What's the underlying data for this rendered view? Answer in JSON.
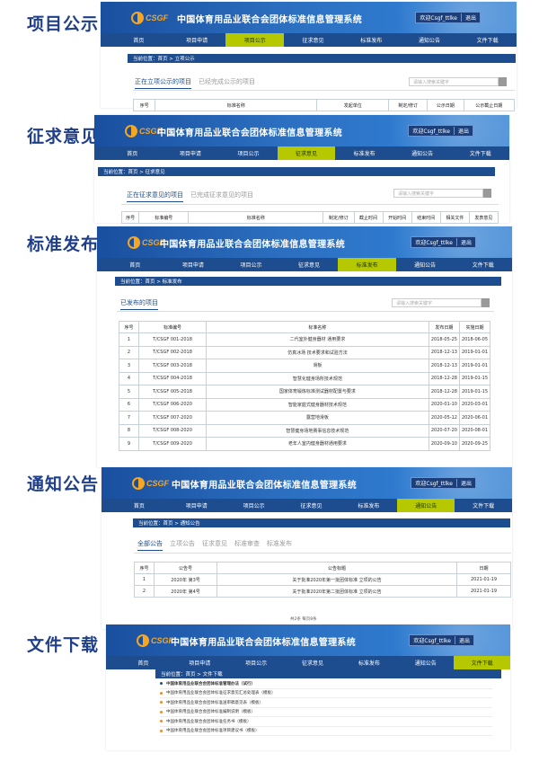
{
  "header": {
    "logo_text": "CSGF",
    "site_title": "中国体育用品业联合会团体标准信息管理系统",
    "user": "欢迎Csgf_ttlke",
    "logout": "退出"
  },
  "nav": [
    "首页",
    "项目申请",
    "项目公示",
    "征求意见",
    "标准发布",
    "通知公告",
    "文件下载"
  ],
  "sections": {
    "s1": {
      "label": "项目公示",
      "crumb": "当前位置：首页 > 立项公示",
      "tabs": [
        "正在立项公示的项目",
        "已经完成公示的项目"
      ],
      "search_placeholder": "请输入搜索关键字",
      "cols": [
        "序号",
        "标准名称",
        "发起单位",
        "制定/修订",
        "公示日期",
        "公示截止日期"
      ]
    },
    "s2": {
      "label": "征求意见",
      "crumb": "当前位置：首页 > 征求意见",
      "tabs": [
        "正在征求意见的项目",
        "已完成征求意见的项目"
      ],
      "search_placeholder": "请输入搜索关键字",
      "cols": [
        "序号",
        "标准编号",
        "标准名称",
        "制定/修订",
        "截止时间",
        "开始时间",
        "结束时间",
        "相关文件",
        "发表意见"
      ]
    },
    "s3": {
      "label": "标准发布",
      "crumb": "当前位置：首页 > 标准发布",
      "tab": "已发布的项目",
      "search_placeholder": "请输入搜索关键字",
      "cols": [
        "序号",
        "标准编号",
        "标准名称",
        "发布日期",
        "实施日期"
      ],
      "rows": [
        [
          "1",
          "T/CSGF 001-2018",
          "二代室外健身器材 通用要求",
          "2018-05-25",
          "2018-06-05"
        ],
        [
          "2",
          "T/CSGF 002-2018",
          "仿真冰场 技术要求和试验方法",
          "2018-12-13",
          "2019-01-01"
        ],
        [
          "3",
          "T/CSGF 003-2018",
          "滑板",
          "2018-12-13",
          "2019-01-01"
        ],
        [
          "4",
          "T/CSGF 004-2018",
          "智慧化健身场所技术规范",
          "2018-12-28",
          "2019-01-15"
        ],
        [
          "5",
          "T/CSGF 005-2018",
          "国家体育锻炼标准测试器材配置与要求",
          "2018-12-28",
          "2019-01-15"
        ],
        [
          "6",
          "T/CSGF 006-2020",
          "智能家庭式健身器材技术规范",
          "2020-01-10",
          "2020-03-01"
        ],
        [
          "7",
          "T/CSGF 007-2020",
          "露营地滑板",
          "2020-05-12",
          "2020-06-01"
        ],
        [
          "8",
          "T/CSGF 008-2020",
          "智慧健身场地赛事信息技术规范",
          "2020-07-20",
          "2020-08-01"
        ],
        [
          "9",
          "T/CSGF 009-2020",
          "老年人室内健身器材通用要求",
          "2020-09-10",
          "2020-09-25"
        ]
      ]
    },
    "s4": {
      "label": "通知公告",
      "crumb": "当前位置：首页 > 通知公告",
      "tabs": [
        "全部公告",
        "立项公告",
        "征求意见",
        "标准审查",
        "标准发布"
      ],
      "cols": [
        "序号",
        "公告号",
        "公告标题",
        "日期"
      ],
      "rows": [
        [
          "1",
          "2020年 第3号",
          "关于批准2020年第一批团体标准 立项的公告",
          "2021-01-19"
        ],
        [
          "2",
          "2020年 第4号",
          "关于批准2020年第二批团体标准 立项的公告",
          "2021-01-19"
        ]
      ],
      "pager": "共2条  每页8条"
    },
    "s5": {
      "label": "文件下载",
      "crumb": "当前位置：首页 > 文件下载",
      "files": [
        "中国体育用品业联合会团体标准管理办法（试行）",
        "中国体育用品业联合会团体标准征求意见汇总处理表（模板）",
        "中国体育用品业联合会团体标准送审稿意见表（模板）",
        "中国体育用品业联合会团体标准编制说明（模板）",
        "中国体育用品业联合会团体标准任务书（模板）",
        "中国体育用品业联合会团体标准项目建议书（模板）"
      ]
    }
  },
  "colors": {
    "header_blue": "#1e4d8f",
    "nav_active": "#b5c800",
    "label_blue": "#1f3f8a"
  }
}
